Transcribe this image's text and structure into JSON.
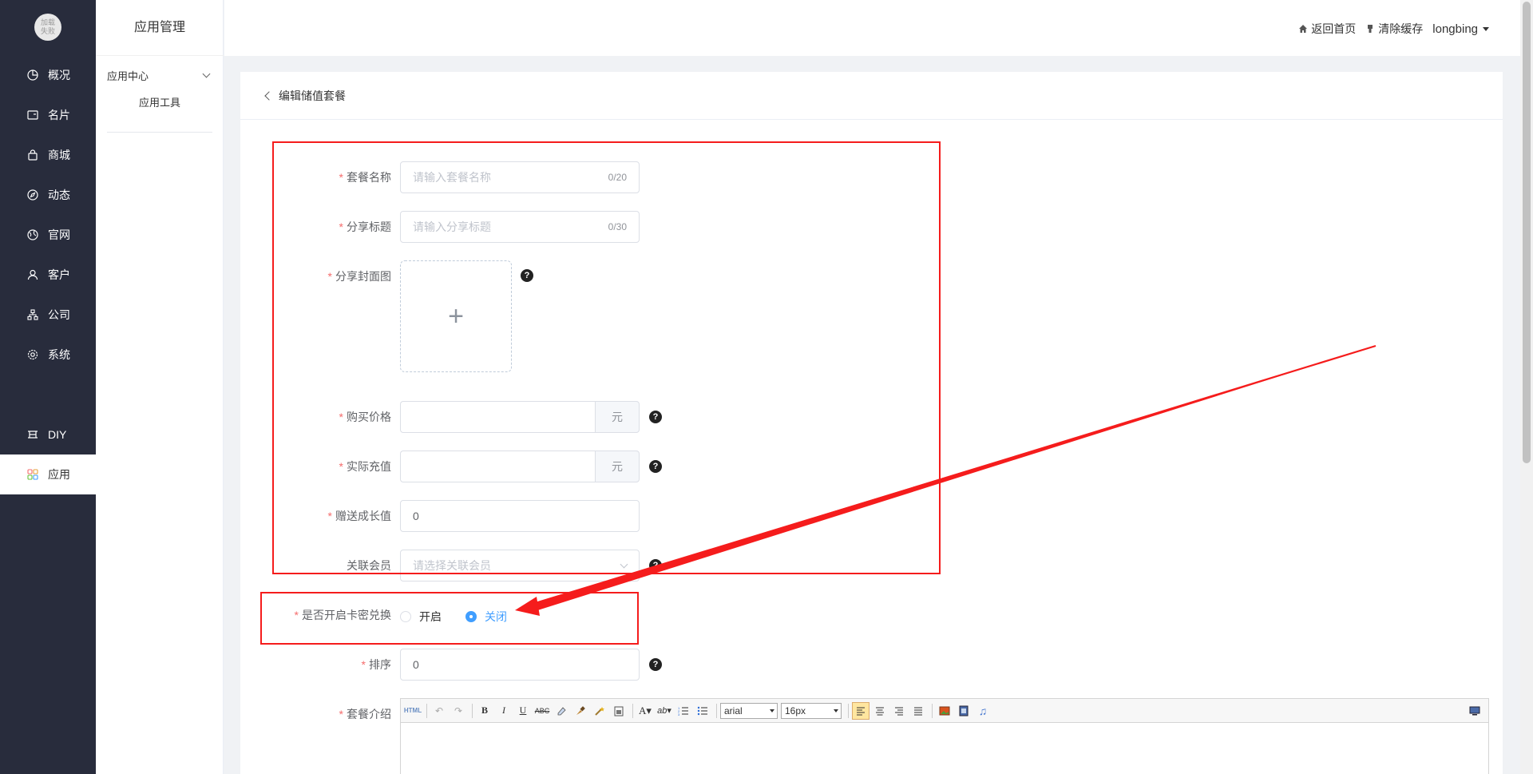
{
  "sidebar": {
    "logo_text": "加载\n失败",
    "items": [
      {
        "label": "概况",
        "icon": "pie-chart-icon"
      },
      {
        "label": "名片",
        "icon": "card-icon"
      },
      {
        "label": "商城",
        "icon": "shopping-bag-icon"
      },
      {
        "label": "动态",
        "icon": "compass-icon"
      },
      {
        "label": "官网",
        "icon": "globe-icon"
      },
      {
        "label": "客户",
        "icon": "user-icon"
      },
      {
        "label": "公司",
        "icon": "org-chart-icon"
      },
      {
        "label": "系统",
        "icon": "gear-icon"
      },
      {
        "label": "DIY",
        "icon": "diy-icon"
      },
      {
        "label": "应用",
        "icon": "apps-grid-icon",
        "active": true
      }
    ]
  },
  "submenu": {
    "title": "应用管理",
    "group_label": "应用中心",
    "item_label": "应用工具"
  },
  "topbar": {
    "home_label": "返回首页",
    "clear_cache_label": "清除缓存",
    "username": "longbing"
  },
  "page": {
    "title": "编辑储值套餐"
  },
  "form": {
    "package_name": {
      "label": "套餐名称",
      "required": true,
      "placeholder": "请输入套餐名称",
      "count": "0/20"
    },
    "share_title": {
      "label": "分享标题",
      "required": true,
      "placeholder": "请输入分享标题",
      "count": "0/30"
    },
    "share_cover": {
      "label": "分享封面图",
      "required": true
    },
    "purchase_price": {
      "label": "购买价格",
      "required": true,
      "value": "",
      "unit": "元"
    },
    "actual_recharge": {
      "label": "实际充值",
      "required": true,
      "value": "",
      "unit": "元"
    },
    "bonus_growth": {
      "label": "赠送成长值",
      "required": true,
      "value": "0"
    },
    "linked_member": {
      "label": "关联会员",
      "required": false,
      "placeholder": "请选择关联会员"
    },
    "card_exchange": {
      "label": "是否开启卡密兑换",
      "required": true,
      "options": [
        "开启",
        "关闭"
      ],
      "selected": "关闭"
    },
    "sort": {
      "label": "排序",
      "required": true,
      "value": "0"
    },
    "intro": {
      "label": "套餐介绍",
      "required": true
    }
  },
  "editor": {
    "font_family": "arial",
    "font_size": "16px",
    "html_label": "HTML"
  },
  "colors": {
    "sidebar_bg": "#282c3c",
    "accent": "#409eff",
    "required": "#f56c6c",
    "annotation": "#f51c1c"
  }
}
